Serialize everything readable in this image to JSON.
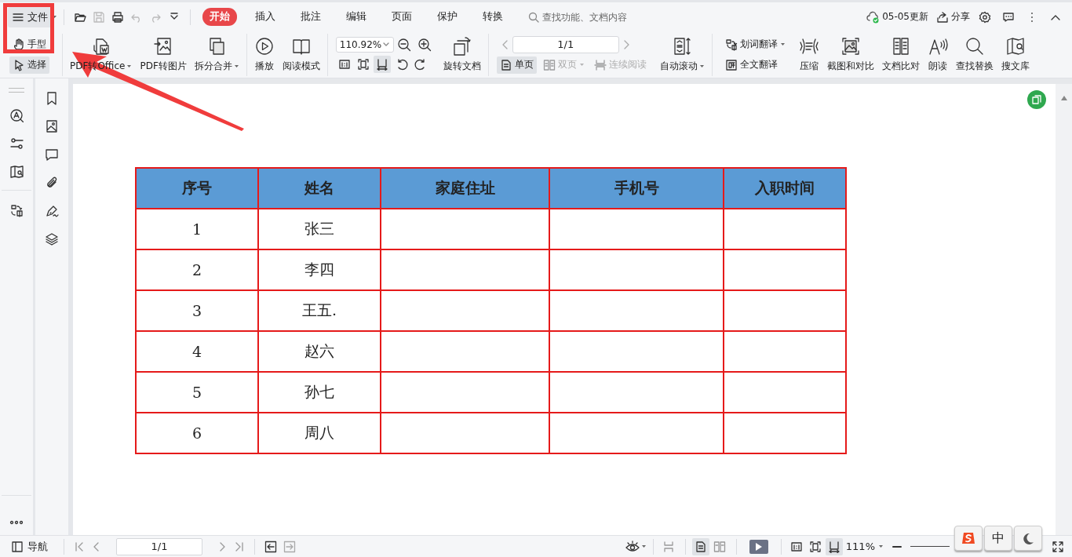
{
  "annotation": {
    "box": true,
    "arrow": true
  },
  "menu_button": {
    "label": "文件"
  },
  "tabs": [
    {
      "label": "开始",
      "selected": true
    },
    {
      "label": "插入",
      "selected": false
    },
    {
      "label": "批注",
      "selected": false
    },
    {
      "label": "编辑",
      "selected": false
    },
    {
      "label": "页面",
      "selected": false
    },
    {
      "label": "保护",
      "selected": false
    },
    {
      "label": "转换",
      "selected": false
    }
  ],
  "search": {
    "placeholder": "查找功能、文档内容"
  },
  "sync_status": {
    "label": "05-05更新"
  },
  "share_button": {
    "label": "分享"
  },
  "ribbon": {
    "tools": [
      {
        "label": "手型",
        "selected": false
      },
      {
        "label": "选择",
        "selected": true
      }
    ],
    "convert": [
      {
        "label": "PDF转Office",
        "dropdown": true
      },
      {
        "label": "PDF转图片",
        "dropdown": false
      },
      {
        "label": "拆分合并",
        "dropdown": true
      }
    ],
    "reading": [
      {
        "label": "播放"
      },
      {
        "label": "阅读模式"
      }
    ],
    "zoom": {
      "value": "110.92%"
    },
    "fit_modes": [
      {
        "selected": false
      },
      {
        "selected": false
      },
      {
        "selected": true
      }
    ],
    "rotate_button": {
      "label": "旋转文档"
    },
    "page_field": {
      "value": "1/1"
    },
    "page_modes": [
      {
        "label": "单页",
        "selected": true,
        "disabled": false,
        "dropdown": false
      },
      {
        "label": "双页",
        "selected": false,
        "disabled": true,
        "dropdown": true
      },
      {
        "label": "连续阅读",
        "selected": false,
        "disabled": true,
        "dropdown": false
      }
    ],
    "auto_scroll": {
      "label": "自动滚动"
    },
    "translate": [
      {
        "label": "划词翻译",
        "dropdown": true
      },
      {
        "label": "全文翻译",
        "dropdown": false
      }
    ],
    "tools_right": [
      {
        "label": "压缩"
      },
      {
        "label": "截图和对比"
      },
      {
        "label": "文档比对"
      },
      {
        "label": "朗读"
      },
      {
        "label": "查找替换"
      },
      {
        "label": "搜文库"
      }
    ]
  },
  "table": {
    "columns": [
      "序号",
      "姓名",
      "家庭住址",
      "手机号",
      "入职时间"
    ],
    "rows": [
      [
        "1",
        "张三"
      ],
      [
        "2",
        "李四"
      ],
      [
        "3",
        "王五."
      ],
      [
        "4",
        "赵六"
      ],
      [
        "5",
        "孙七"
      ],
      [
        "6",
        "周八"
      ]
    ]
  },
  "status_bar": {
    "nav_button": {
      "label": "导航"
    },
    "page_field": {
      "value": "1/1"
    },
    "view_modes": [
      {
        "selected": false
      },
      {
        "selected": true
      },
      {
        "selected": false
      }
    ],
    "fit_modes": [
      {
        "selected": false
      },
      {
        "selected": false
      },
      {
        "selected": true
      }
    ],
    "zoom": {
      "value": "111%"
    }
  },
  "ime_toolbar": {
    "mode": "中"
  }
}
